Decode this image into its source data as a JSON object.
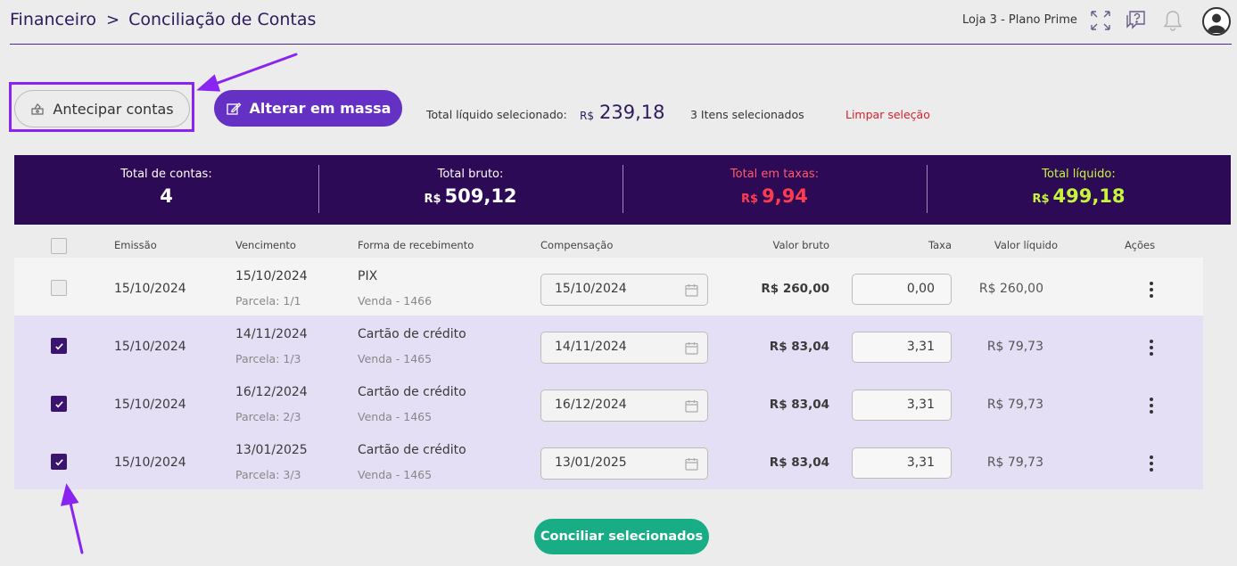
{
  "breadcrumb": {
    "section": "Financeiro",
    "separator": ">",
    "page": "Conciliação de Contas"
  },
  "header": {
    "store": "Loja 3 - Plano Prime",
    "icons": [
      "fullscreen-icon",
      "help-chat-icon",
      "bell-icon",
      "user-avatar-icon"
    ]
  },
  "toolbar": {
    "antecipar_label": "Antecipar contas",
    "massa_label": "Alterar em massa",
    "selected_label": "Total líquido selecionado:",
    "selected_currency": "R$",
    "selected_value": "239,18",
    "selected_count": "3 Itens selecionados",
    "clear_label": "Limpar seleção"
  },
  "summary": {
    "contas": {
      "label": "Total de contas:",
      "value": "4"
    },
    "bruto": {
      "label": "Total bruto:",
      "currency": "R$",
      "value": "509,12"
    },
    "taxas": {
      "label": "Total em taxas:",
      "currency": "R$",
      "value": "9,94"
    },
    "liquido": {
      "label": "Total líquido:",
      "currency": "R$",
      "value": "499,18"
    }
  },
  "table": {
    "headers": {
      "emissao": "Emissão",
      "vencimento": "Vencimento",
      "forma": "Forma de recebimento",
      "compensacao": "Compensação",
      "bruto": "Valor bruto",
      "taxa": "Taxa",
      "liquido": "Valor líquido",
      "acoes": "Ações"
    },
    "rows": [
      {
        "checked": false,
        "emissao": "15/10/2024",
        "vencimento": "15/10/2024",
        "parcela": "Parcela: 1/1",
        "forma": "PIX",
        "venda": "Venda - 1466",
        "compensacao": "15/10/2024",
        "bruto": "R$ 260,00",
        "taxa": "0,00",
        "liquido": "R$ 260,00"
      },
      {
        "checked": true,
        "emissao": "15/10/2024",
        "vencimento": "14/11/2024",
        "parcela": "Parcela: 1/3",
        "forma": "Cartão de crédito",
        "venda": "Venda - 1465",
        "compensacao": "14/11/2024",
        "bruto": "R$ 83,04",
        "taxa": "3,31",
        "liquido": "R$ 79,73"
      },
      {
        "checked": true,
        "emissao": "15/10/2024",
        "vencimento": "16/12/2024",
        "parcela": "Parcela: 2/3",
        "forma": "Cartão de crédito",
        "venda": "Venda - 1465",
        "compensacao": "16/12/2024",
        "bruto": "R$ 83,04",
        "taxa": "3,31",
        "liquido": "R$ 79,73"
      },
      {
        "checked": true,
        "emissao": "15/10/2024",
        "vencimento": "13/01/2025",
        "parcela": "Parcela: 3/3",
        "forma": "Cartão de crédito",
        "venda": "Venda - 1465",
        "compensacao": "13/01/2025",
        "bruto": "R$ 83,04",
        "taxa": "3,31",
        "liquido": "R$ 79,73"
      }
    ]
  },
  "footer": {
    "conciliar_label": "Conciliar selecionados"
  },
  "colors": {
    "brand_purple": "#6531c4",
    "summary_bg": "#2d0a55",
    "selected_row": "#e4dff5",
    "taxas_red": "#ff3b4e",
    "liquido_green": "#c7f53a",
    "conciliar_green": "#18ad84",
    "annotation": "#8a24f0"
  }
}
